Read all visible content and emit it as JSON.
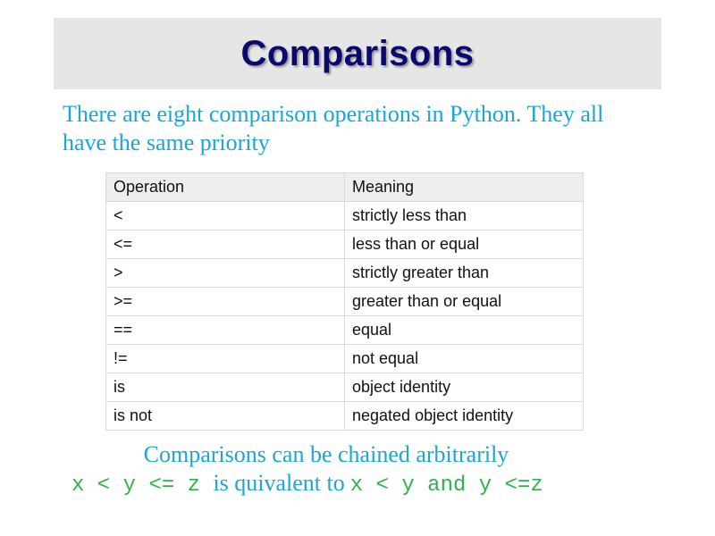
{
  "slide": {
    "title": "Comparisons",
    "intro_text": "There are eight comparison operations in Python. They all have the same priority",
    "table": {
      "headers": [
        "Operation",
        "Meaning"
      ],
      "rows": [
        [
          "<",
          "strictly less than"
        ],
        [
          "<=",
          "less than or equal"
        ],
        [
          ">",
          "strictly greater than"
        ],
        [
          ">=",
          "greater than or equal"
        ],
        [
          "==",
          "equal"
        ],
        [
          "!=",
          "not equal"
        ],
        [
          "is",
          "object identity"
        ],
        [
          "is not",
          "negated object identity"
        ]
      ]
    },
    "chain_note": "Comparisons can be chained arbitrarily",
    "example": {
      "left_code": "x < y <= z ",
      "middle_text": "is quivalent to",
      "right_code": "x < y and y <=z"
    }
  },
  "colors": {
    "title_text": "#0a0a6e",
    "title_bar": "#e6e6e6",
    "body_text": "#1aa6d6",
    "code_text": "#2fb34a",
    "table_header_bg": "#eeeeee",
    "table_border": "#d9d9d9"
  }
}
